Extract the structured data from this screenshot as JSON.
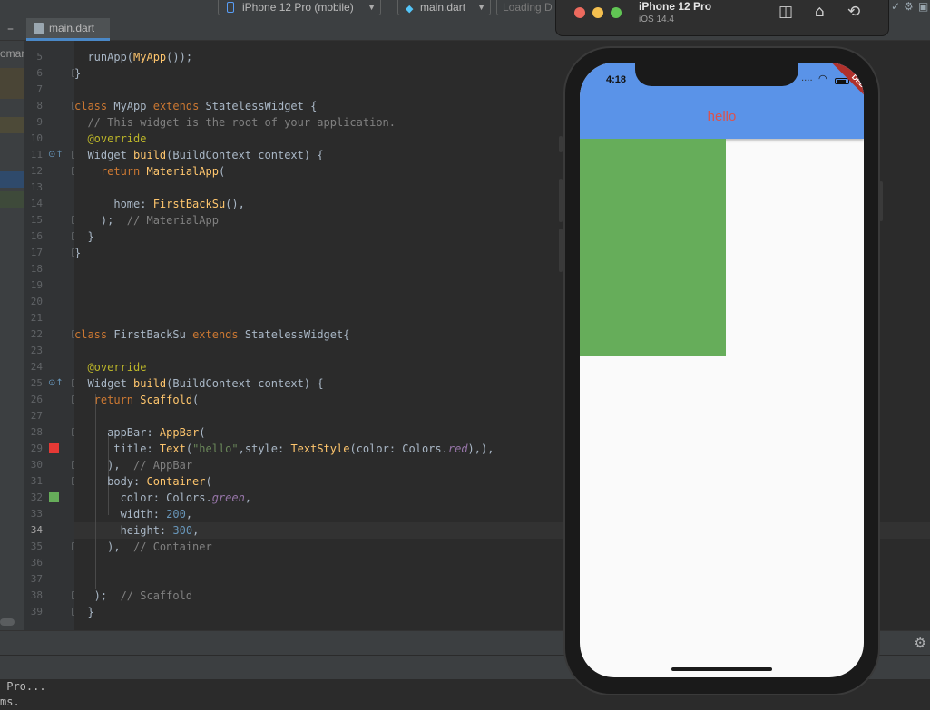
{
  "toolbar": {
    "device_select": "iPhone 12 Pro (mobile)",
    "config_select": "main.dart",
    "status_text": "Loading D"
  },
  "editor_tab": {
    "label": "main.dart"
  },
  "left_panel": {
    "project_label": "omar"
  },
  "code": {
    "line_numbers": [
      "5",
      "6",
      "7",
      "8",
      "9",
      "10",
      "11",
      "12",
      "13",
      "14",
      "15",
      "16",
      "17",
      "18",
      "19",
      "20",
      "21",
      "22",
      "23",
      "24",
      "25",
      "26",
      "27",
      "28",
      "29",
      "30",
      "31",
      "32",
      "33",
      "34",
      "35",
      "36",
      "37",
      "38",
      "39"
    ],
    "current_line": "34",
    "lines": [
      [
        {
          "t": "  runApp("
        },
        {
          "t": "MyApp",
          "c": "fn"
        },
        {
          "t": "());"
        }
      ],
      [
        {
          "t": "}"
        }
      ],
      [],
      [
        {
          "t": "class ",
          "c": "kw"
        },
        {
          "t": "MyApp "
        },
        {
          "t": "extends ",
          "c": "kw"
        },
        {
          "t": "StatelessWidget {"
        }
      ],
      [
        {
          "t": "  // This widget is the root of your application.",
          "c": "cmt"
        }
      ],
      [
        {
          "t": "  @override",
          "c": "ann"
        }
      ],
      [
        {
          "t": "  Widget "
        },
        {
          "t": "build",
          "c": "fn"
        },
        {
          "t": "(BuildContext context) {"
        }
      ],
      [
        {
          "t": "    return ",
          "c": "kw"
        },
        {
          "t": "MaterialApp",
          "c": "fn"
        },
        {
          "t": "("
        }
      ],
      [],
      [
        {
          "t": "      home: "
        },
        {
          "t": "FirstBackSu",
          "c": "fn"
        },
        {
          "t": "(),"
        }
      ],
      [
        {
          "t": "    );  "
        },
        {
          "t": "// MaterialApp",
          "c": "cmt"
        }
      ],
      [
        {
          "t": "  }"
        }
      ],
      [
        {
          "t": "}"
        }
      ],
      [],
      [],
      [],
      [],
      [
        {
          "t": "class ",
          "c": "kw"
        },
        {
          "t": "FirstBackSu "
        },
        {
          "t": "extends ",
          "c": "kw"
        },
        {
          "t": "StatelessWidget{"
        }
      ],
      [],
      [
        {
          "t": "  @override",
          "c": "ann"
        }
      ],
      [
        {
          "t": "  Widget "
        },
        {
          "t": "build",
          "c": "fn"
        },
        {
          "t": "(BuildContext context) {"
        }
      ],
      [
        {
          "t": "   return ",
          "c": "kw"
        },
        {
          "t": "Scaffold",
          "c": "fn"
        },
        {
          "t": "("
        }
      ],
      [],
      [
        {
          "t": "     appBar: "
        },
        {
          "t": "AppBar",
          "c": "fn"
        },
        {
          "t": "("
        }
      ],
      [
        {
          "t": "      title: "
        },
        {
          "t": "Text",
          "c": "fn"
        },
        {
          "t": "("
        },
        {
          "t": "\"hello\"",
          "c": "str"
        },
        {
          "t": ",style: "
        },
        {
          "t": "TextStyle",
          "c": "fn"
        },
        {
          "t": "(color: Colors."
        },
        {
          "t": "red",
          "c": "ital"
        },
        {
          "t": "),),"
        }
      ],
      [
        {
          "t": "     ),  "
        },
        {
          "t": "// AppBar",
          "c": "cmt"
        }
      ],
      [
        {
          "t": "     body: "
        },
        {
          "t": "Container",
          "c": "fn"
        },
        {
          "t": "("
        }
      ],
      [
        {
          "t": "       color: Colors."
        },
        {
          "t": "green",
          "c": "ital"
        },
        {
          "t": ","
        }
      ],
      [
        {
          "t": "       width: "
        },
        {
          "t": "200",
          "c": "num"
        },
        {
          "t": ","
        }
      ],
      [
        {
          "t": "       height: "
        },
        {
          "t": "300",
          "c": "num"
        },
        {
          "t": ","
        }
      ],
      [
        {
          "t": "     ),  "
        },
        {
          "t": "// Container",
          "c": "cmt"
        }
      ],
      [],
      [],
      [
        {
          "t": "   );  "
        },
        {
          "t": "// Scaffold",
          "c": "cmt"
        }
      ],
      [
        {
          "t": "  }"
        }
      ]
    ]
  },
  "console": {
    "lines": [
      " Pro...",
      "ms."
    ]
  },
  "simulator": {
    "title": "iPhone 12 Pro",
    "subtitle": "iOS 14.4",
    "status_time": "4:18",
    "app_title": "hello",
    "debug_banner": "DEBUG",
    "colors": {
      "app_bar": "#5a93e8",
      "title_text": "#d9534f",
      "body_box": "#66ad5a",
      "background": "#fafafa"
    },
    "icons": [
      "screenshot-icon",
      "home-icon",
      "rotate-icon"
    ]
  },
  "swatches": {
    "red": "#e53935",
    "green": "#66ad5a"
  }
}
